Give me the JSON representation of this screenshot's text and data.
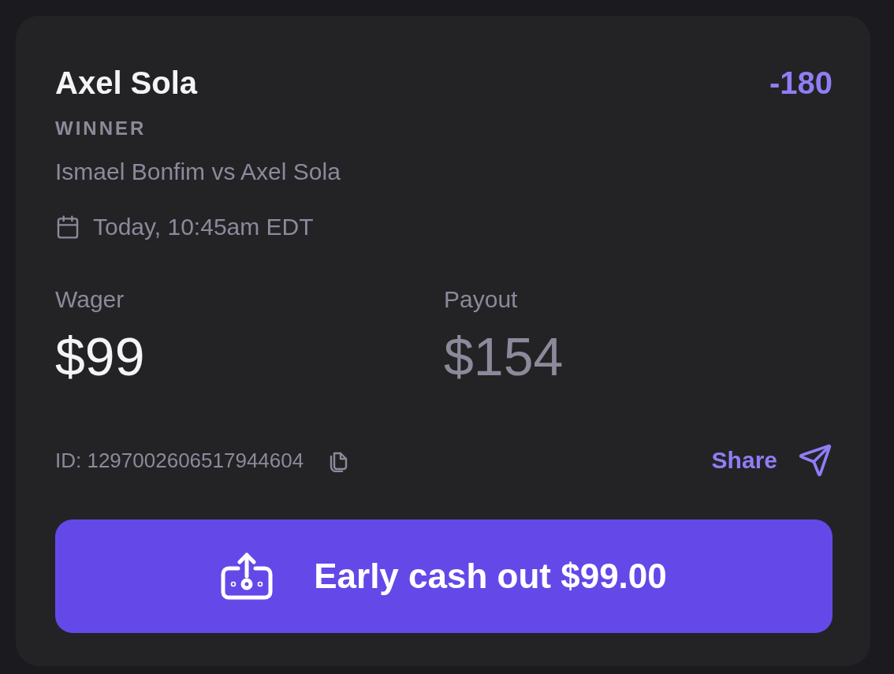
{
  "bet": {
    "selection": "Axel Sola",
    "odds": "-180",
    "market": "WINNER",
    "matchup": "Ismael Bonfim vs Axel Sola",
    "start_time": "Today, 10:45am EDT"
  },
  "stats": [
    {
      "label": "Wager",
      "value": "$99",
      "kind": "primary"
    },
    {
      "label": "Payout",
      "value": "$154",
      "kind": "muted"
    }
  ],
  "bet_id": "ID: 1297002606517944604",
  "share": {
    "label": "Share"
  },
  "cash_out_button": {
    "label": "Early cash out $99.00"
  }
}
